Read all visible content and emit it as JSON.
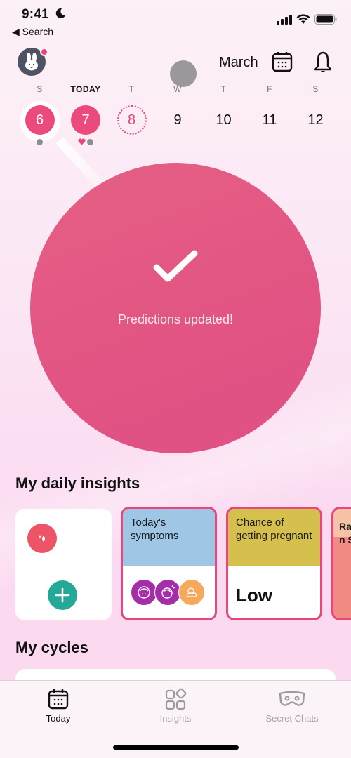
{
  "status_bar": {
    "time": "9:41",
    "back_label": "Search"
  },
  "header": {
    "month": "March"
  },
  "week": [
    {
      "label": "S",
      "date": "6",
      "state": "period",
      "marks": [
        "gray-dot"
      ]
    },
    {
      "label": "TODAY",
      "date": "7",
      "state": "period",
      "marks": [
        "heart",
        "gray-dot"
      ]
    },
    {
      "label": "T",
      "date": "8",
      "state": "predicted",
      "marks": []
    },
    {
      "label": "W",
      "date": "9",
      "state": "normal",
      "marks": []
    },
    {
      "label": "T",
      "date": "10",
      "state": "normal",
      "marks": []
    },
    {
      "label": "F",
      "date": "11",
      "state": "normal",
      "marks": []
    },
    {
      "label": "S",
      "date": "12",
      "state": "normal",
      "marks": []
    }
  ],
  "overlay": {
    "message": "Predictions updated!",
    "icon": "check-icon"
  },
  "insights": {
    "title": "My daily insights",
    "cards": [
      {
        "type": "log",
        "icons": [
          "drop-icon",
          "plus-icon"
        ]
      },
      {
        "type": "symptoms",
        "title": "Today's symptoms",
        "header_color": "#9fc7e5",
        "icons": [
          "acne-icon",
          "headache-icon",
          "weather-icon"
        ]
      },
      {
        "type": "chance",
        "title": "Chance of getting pregnant",
        "header_color": "#d5bf4d",
        "value": "Low"
      },
      {
        "type": "partial",
        "title_fragment": "Ra an Sv"
      }
    ]
  },
  "cycles": {
    "title": "My cycles"
  },
  "tabbar": {
    "tabs": [
      {
        "label": "Today",
        "icon": "calendar-icon",
        "active": true
      },
      {
        "label": "Insights",
        "icon": "insights-icon",
        "active": false
      },
      {
        "label": "Secret Chats",
        "icon": "mask-icon",
        "active": false
      }
    ]
  },
  "colors": {
    "accent": "#e6487b",
    "overlay": "#e25483",
    "teal": "#24a898",
    "drop": "#ed5467",
    "purple": "#a42da8",
    "orange": "#f6a95c"
  }
}
